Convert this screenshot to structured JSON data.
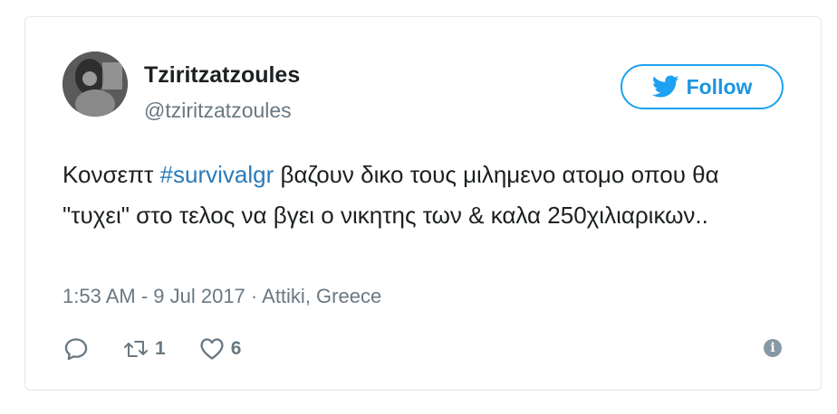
{
  "author": {
    "display_name": "Tziritzatzoules",
    "handle": "@tziritzatzoules"
  },
  "follow": {
    "label": "Follow",
    "icon": "twitter-bird-icon"
  },
  "tweet": {
    "text_before": "Κονσεπτ ",
    "hashtag": "#survivalgr",
    "text_after": " βαζουν δικο τους μιλημενο ατομο οπου θα \"τυχει\" στο τελος να βγει ο νικητης των & καλα 250χιλιαρικων..",
    "timestamp": "1:53 AM - 9 Jul 2017",
    "separator": " · ",
    "location": "Attiki, Greece"
  },
  "actions": {
    "reply": {
      "icon": "reply-icon"
    },
    "retweet": {
      "icon": "retweet-icon",
      "count": "1"
    },
    "like": {
      "icon": "heart-icon",
      "count": "6"
    },
    "info": {
      "icon": "info-icon",
      "glyph": "i"
    }
  },
  "colors": {
    "link": "#2b7bb9",
    "accent": "#1da1f2",
    "muted": "#697882"
  }
}
